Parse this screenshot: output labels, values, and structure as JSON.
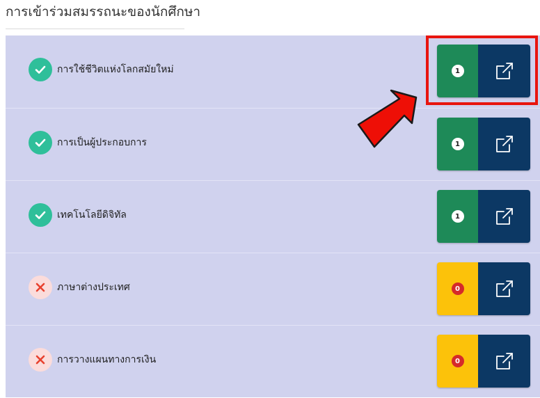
{
  "header": {
    "title": "การเข้าร่วมสมรรถนะของนักศึกษา"
  },
  "items": [
    {
      "label": "การใช้ชีวิตแห่งโลกสมัยใหม่",
      "status": "ok",
      "count": "1"
    },
    {
      "label": "การเป็นผู้ประกอบการ",
      "status": "ok",
      "count": "1"
    },
    {
      "label": "เทคโนโลยีดิจิทัล",
      "status": "ok",
      "count": "1"
    },
    {
      "label": "ภาษาต่างประเทศ",
      "status": "fail",
      "count": "0"
    },
    {
      "label": "การวางแผนทางการเงิน",
      "status": "fail",
      "count": "0"
    }
  ],
  "icons": {
    "done": "check-icon",
    "not_done": "close-icon",
    "open": "external-link-icon"
  },
  "colors": {
    "list_background": "#d0d2ee",
    "complete_status": "#2fbf9a",
    "complete_counter": "#1e8a58",
    "incomplete_status": "#fbdcdb",
    "incomplete_counter": "#fcc20a",
    "incomplete_badge": "#d52a2a",
    "link_button": "#0c3864",
    "annotation": "#e8150f"
  }
}
